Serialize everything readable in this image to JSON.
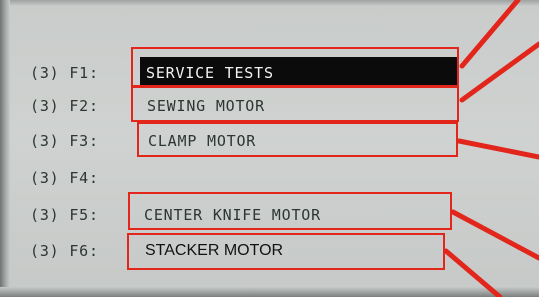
{
  "display": {
    "rows": [
      {
        "label": "(3) F1:",
        "value": "SERVICE TESTS",
        "selected": true
      },
      {
        "label": "(3) F2:",
        "value": "SEWING MOTOR",
        "selected": false
      },
      {
        "label": "(3) F3:",
        "value": "CLAMP MOTOR",
        "selected": false
      },
      {
        "label": "(3) F4:",
        "value": "",
        "selected": false
      },
      {
        "label": "(3) F5:",
        "value": "CENTER KNIFE MOTOR",
        "selected": false
      },
      {
        "label": "(3) F6:",
        "value": "STACKER MOTOR",
        "selected": false
      }
    ]
  },
  "colors": {
    "lcd_background": "#cfd2d0",
    "lcd_text": "#2d3633",
    "selection_background": "#0b0b0b",
    "selection_text": "#f2f2f2",
    "annotation": "#e2261c"
  }
}
